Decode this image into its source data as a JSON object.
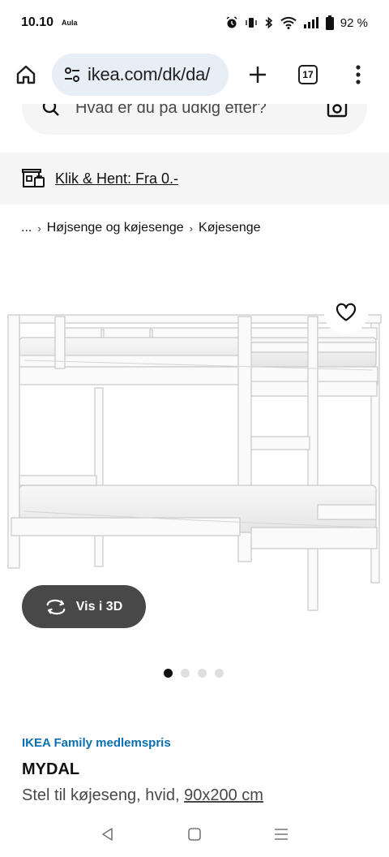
{
  "status_bar": {
    "time": "10.10",
    "carrier": "Aula",
    "battery": "92 %"
  },
  "browser": {
    "url": "ikea.com/dk/da/",
    "tab_count": "17"
  },
  "search": {
    "placeholder": "Hvad er du på udkig efter?"
  },
  "banner": {
    "text": "Klik & Hent: Fra 0.-"
  },
  "breadcrumb": {
    "ellipsis": "...",
    "items": [
      "Højsenge og køjesenge",
      "Køjesenge"
    ]
  },
  "product": {
    "view_3d_label": "Vis i 3D",
    "carousel_total": 4,
    "carousel_active": 1,
    "family_price_label": "IKEA Family medlemspris",
    "name": "MYDAL",
    "description": "Stel til køjeseng, hvid,",
    "size": "90x200 cm"
  },
  "colors": {
    "family_blue": "#0a6fb0",
    "button_dark": "#484848"
  }
}
